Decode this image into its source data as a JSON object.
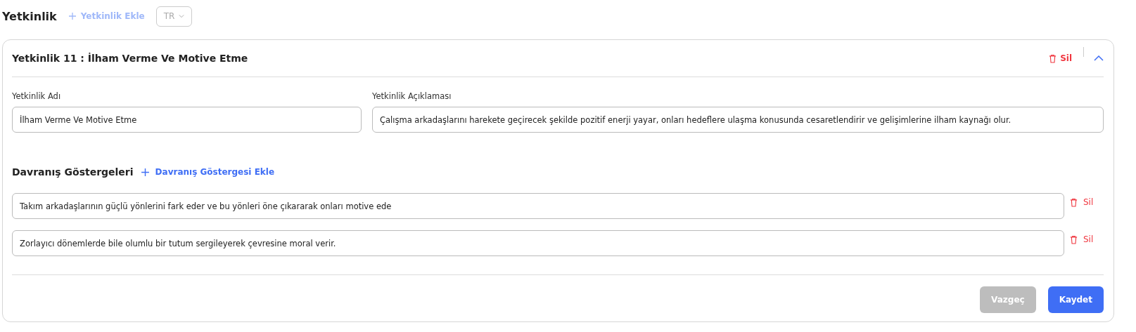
{
  "page": {
    "title": "Yetkinlik",
    "add_link": {
      "label": "Yetkinlik Ekle",
      "disabled": true
    },
    "language": {
      "value": "TR",
      "disabled": true
    }
  },
  "card": {
    "title": "Yetkinlik 11 : İlham Verme Ve Motive Etme",
    "delete_label": "Sil",
    "expanded": true,
    "fields": [
      {
        "label": "Yetkinlik Adı",
        "value": "İlham Verme Ve Motive Etme"
      },
      {
        "label": "Yetkinlik Açıklaması",
        "value": "Çalışma arkadaşlarını harekete geçirecek şekilde pozitif enerji yayar, onları hedeflere ulaşma konusunda cesaretlendirir ve gelişimlerine ilham kaynağı olur."
      }
    ],
    "indicators": {
      "title": "Davranış Göstergeleri",
      "add_label": "Davranış Göstergesi Ekle",
      "items": [
        {
          "value": "Takım arkadaşlarının güçlü yönlerini fark eder ve bu yönleri öne çıkararak onları motive ede",
          "delete_label": "Sil"
        },
        {
          "value": "Zorlayıcı dönemlerde bile olumlu bir tutum sergileyerek çevresine moral verir.",
          "delete_label": "Sil"
        }
      ]
    },
    "buttons": [
      {
        "label": "Vazgeç",
        "kind": "cancel",
        "disabled": true
      },
      {
        "label": "Kaydet",
        "kind": "primary",
        "disabled": false
      }
    ]
  }
}
